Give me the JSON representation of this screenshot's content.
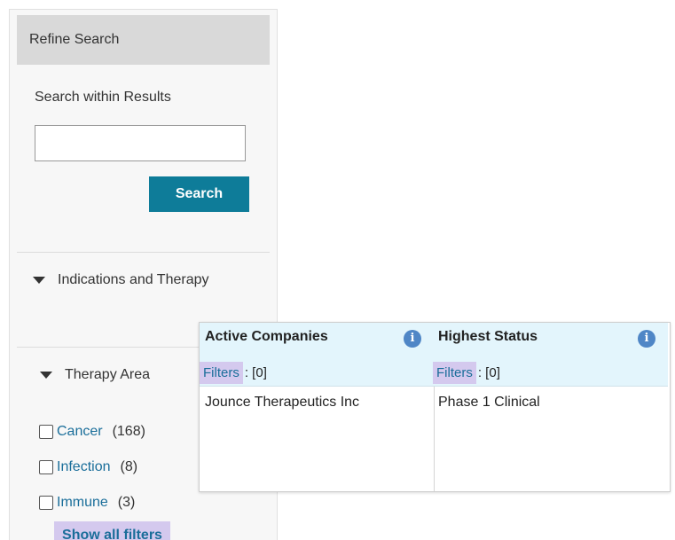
{
  "refine": {
    "header": "Refine Search",
    "search_within_label": "Search within Results",
    "search_input_value": "",
    "search_button": "Search",
    "sections": {
      "indications": "Indications and Therapy",
      "therapy_area": "Therapy Area"
    },
    "filters": [
      {
        "label": "Cancer",
        "count": "(168)"
      },
      {
        "label": "Infection",
        "count": "(8)"
      },
      {
        "label": "Immune",
        "count": "(3)"
      }
    ],
    "show_all": "Show all filters"
  },
  "popup": {
    "columns": [
      {
        "title": "Active Companies",
        "filters_label": "Filters",
        "filters_count": ": [0]",
        "value": "Jounce Therapeutics Inc"
      },
      {
        "title": "Highest Status",
        "filters_label": "Filters",
        "filters_count": ": [0]",
        "value": "Phase 1 Clinical"
      }
    ],
    "info_glyph": "i"
  },
  "colors": {
    "accent": "#0e7c99",
    "link": "#1a6e9a",
    "highlight": "#d4c9ee",
    "header_bg": "#e3f5fc",
    "info_icon": "#4f86c6"
  },
  "icons": [
    "triangle-down-icon",
    "info-icon",
    "checkbox-icon"
  ]
}
